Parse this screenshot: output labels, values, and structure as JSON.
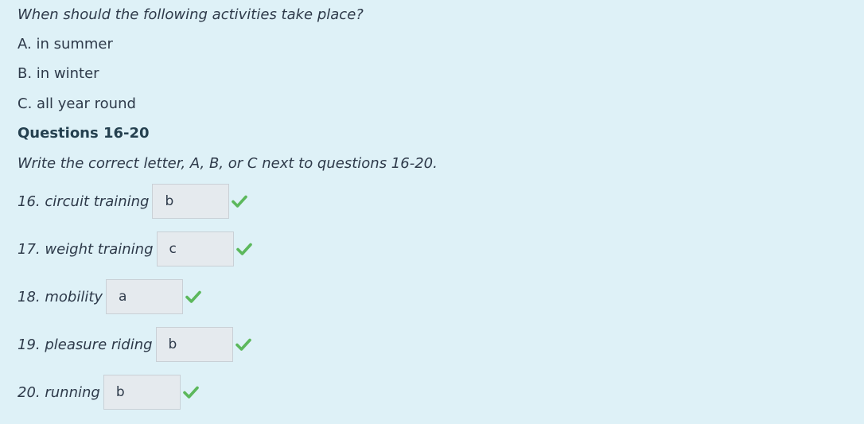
{
  "intro": {
    "question": "When should the following activities take place?",
    "options": [
      "A. in summer",
      "B. in winter",
      "C. all year round"
    ]
  },
  "section": {
    "heading": "Questions 16-20",
    "instruction": "Write the correct letter, A, B, or C next to questions 16-20."
  },
  "questions": [
    {
      "label": "16. circuit training",
      "answer": "b",
      "status": "correct"
    },
    {
      "label": "17. weight training",
      "answer": "c",
      "status": "correct"
    },
    {
      "label": "18. mobility",
      "answer": "a",
      "status": "correct"
    },
    {
      "label": "19. pleasure riding",
      "answer": "b",
      "status": "correct"
    },
    {
      "label": "20. running",
      "answer": "b",
      "status": "correct"
    }
  ],
  "colors": {
    "background": "#def1f7",
    "correct": "#5cb85c"
  },
  "icons": {
    "correct": "check-icon"
  }
}
